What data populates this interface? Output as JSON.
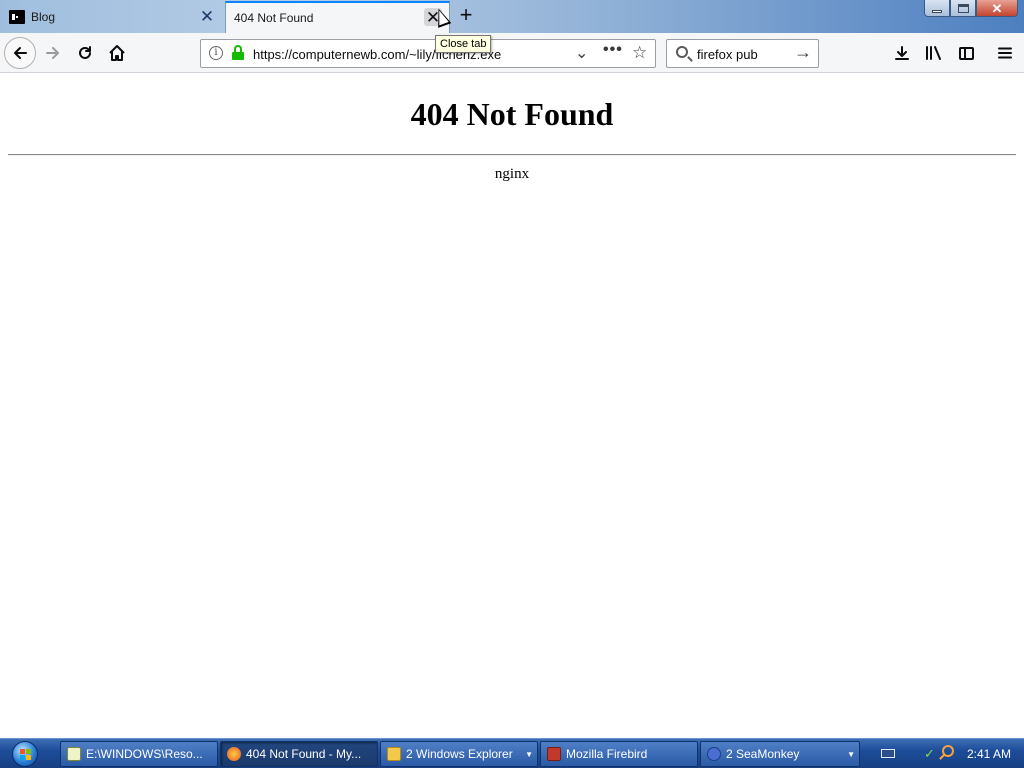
{
  "window": {
    "tabs": [
      {
        "title": "Blog",
        "active": false
      },
      {
        "title": "404 Not Found",
        "active": true
      }
    ],
    "close_tab_tooltip": "Close tab",
    "new_tab_symbol": "+"
  },
  "navbar": {
    "url": "https://computernewb.com/~lily/flchenz.exe",
    "search_value": "firefox pub"
  },
  "page": {
    "heading": "404 Not Found",
    "server": "nginx"
  },
  "taskbar": {
    "buttons": [
      {
        "label": "E:\\WINDOWS\\Reso...",
        "icon": "notepad-icon",
        "active": false
      },
      {
        "label": "404 Not Found - My...",
        "icon": "firefox-icon",
        "active": true
      },
      {
        "label": "2 Windows Explorer",
        "icon": "folder-icon",
        "active": false
      },
      {
        "label": "Mozilla Firebird",
        "icon": "firebird-icon",
        "active": false
      },
      {
        "label": "2 SeaMonkey",
        "icon": "seamonkey-icon",
        "active": false
      }
    ],
    "clock": "2:41 AM"
  },
  "colors": {
    "accent": "#0a84ff",
    "lock_green": "#12bc00",
    "taskbar": "#1d4d99"
  }
}
